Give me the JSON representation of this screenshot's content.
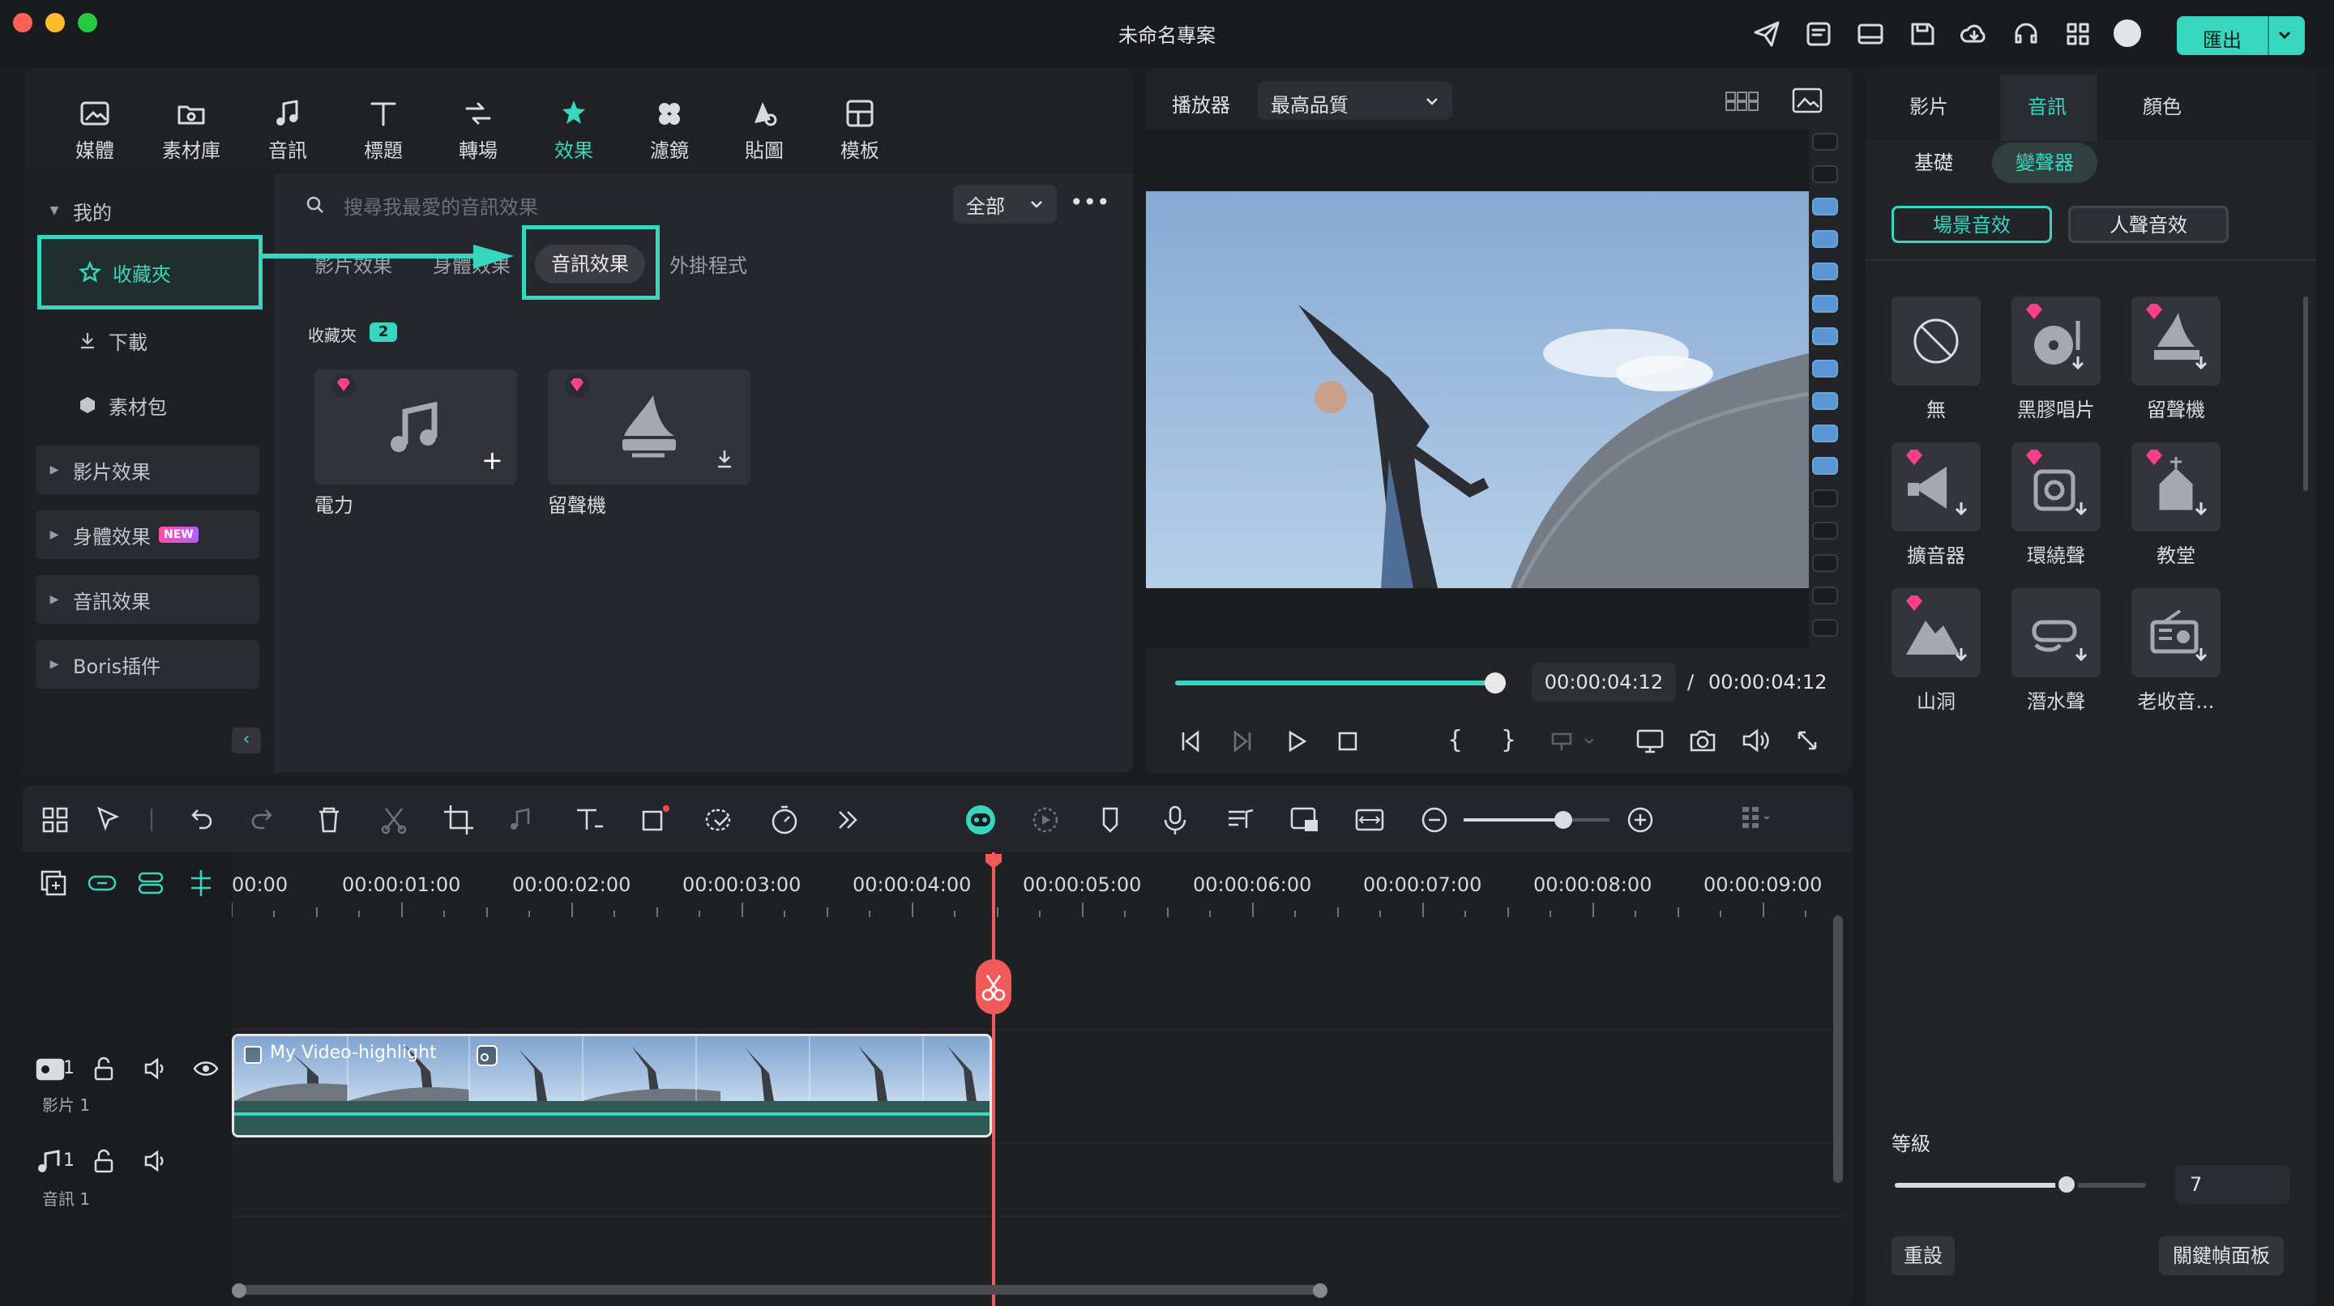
{
  "window": {
    "title": "未命名專案",
    "export_label": "匯出"
  },
  "toolbar": {
    "items": [
      {
        "label": "媒體",
        "icon": "media-icon"
      },
      {
        "label": "素材庫",
        "icon": "stock-icon"
      },
      {
        "label": "音訊",
        "icon": "audio-icon"
      },
      {
        "label": "標題",
        "icon": "title-icon"
      },
      {
        "label": "轉場",
        "icon": "transition-icon"
      },
      {
        "label": "效果",
        "icon": "effects-icon"
      },
      {
        "label": "濾鏡",
        "icon": "filter-icon"
      },
      {
        "label": "貼圖",
        "icon": "sticker-icon"
      },
      {
        "label": "模板",
        "icon": "template-icon"
      }
    ]
  },
  "sidebar": {
    "mine": "我的",
    "favorites": "收藏夾",
    "download": "下載",
    "pack": "素材包",
    "video_effects": "影片效果",
    "body_effects": "身體效果",
    "new_badge": "NEW",
    "audio_effects": "音訊效果",
    "boris": "Boris插件"
  },
  "library": {
    "search_placeholder": "搜尋我最愛的音訊效果",
    "filter": "全部",
    "tabs": [
      "影片效果",
      "身體效果",
      "音訊效果",
      "外掛程式"
    ],
    "section": "收藏夾",
    "count": "2",
    "cards": [
      "電力",
      "留聲機"
    ]
  },
  "player": {
    "label": "播放器",
    "quality": "最高品質",
    "current_time": "00:00:04:12",
    "separator": "/",
    "total_time": "00:00:04:12",
    "progress": 1.0
  },
  "props": {
    "tabs": [
      "影片",
      "音訊",
      "顏色"
    ],
    "seg": [
      "基礎",
      "變聲器"
    ],
    "sub": [
      "場景音效",
      "人聲音效"
    ],
    "voices": [
      "無",
      "黑膠唱片",
      "留聲機",
      "擴音器",
      "環繞聲",
      "教堂",
      "山洞",
      "潛水聲",
      "老收音..."
    ],
    "level_label": "等級",
    "level_value": "7",
    "reset": "重設",
    "keyframe": "關鍵幀面板"
  },
  "timeline": {
    "ticks": [
      "00:00",
      "00:00:01:00",
      "00:00:02:00",
      "00:00:03:00",
      "00:00:04:00",
      "00:00:05:00",
      "00:00:06:00",
      "00:00:07:00",
      "00:00:08:00",
      "00:00:09:00"
    ],
    "clip_title": "My Video-highlight",
    "video_track": "影片 1",
    "audio_track": "音訊 1",
    "track_num": "1"
  }
}
